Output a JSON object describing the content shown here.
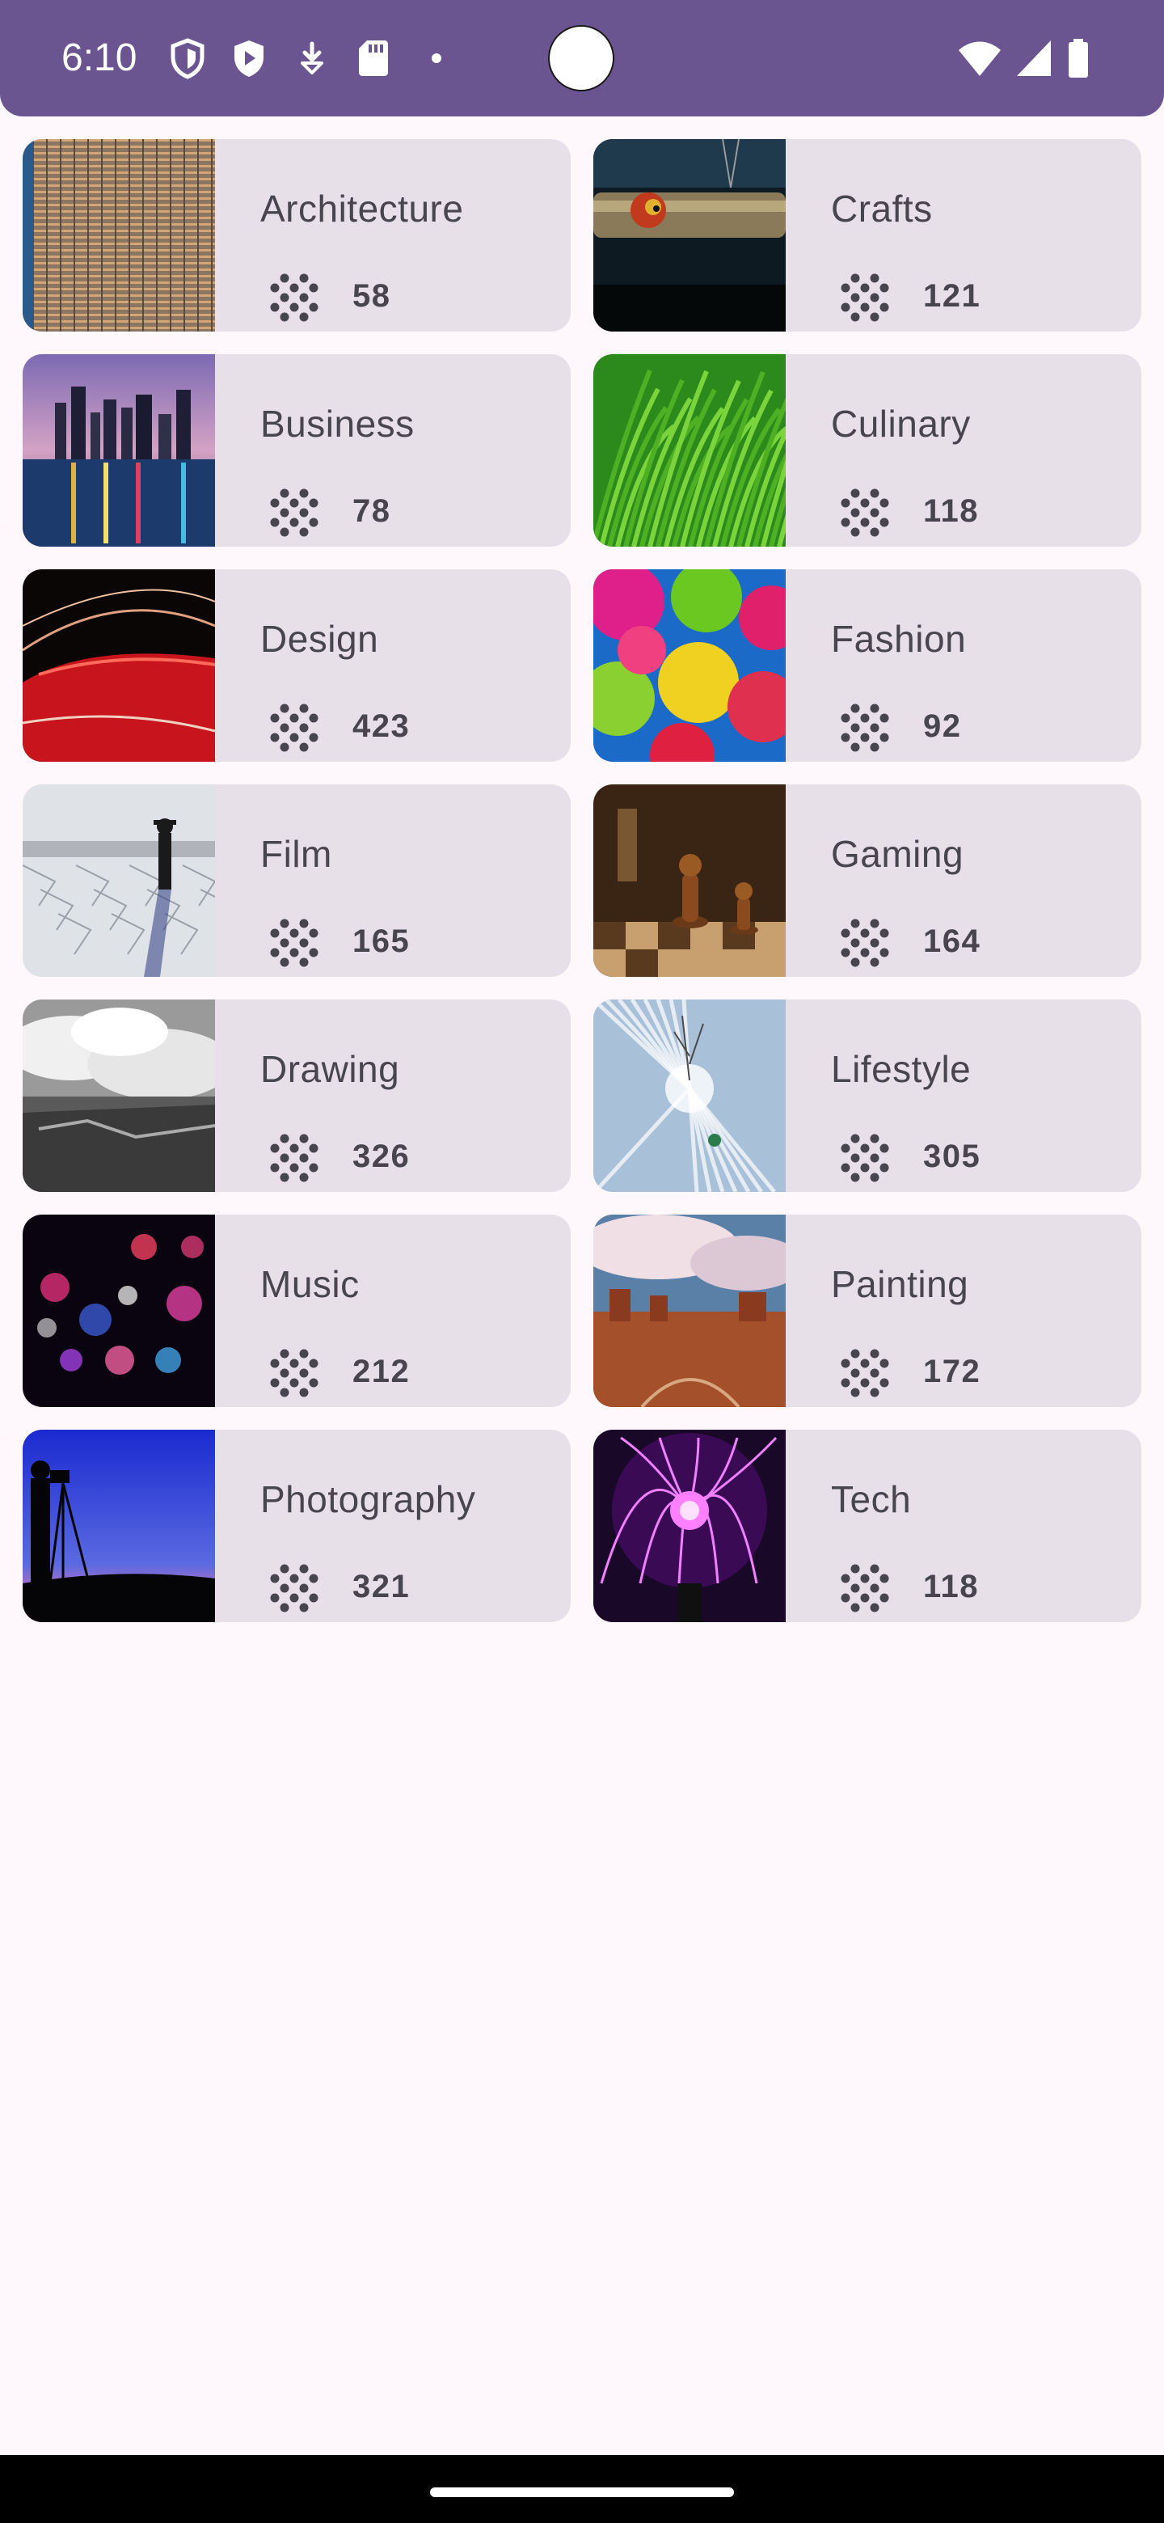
{
  "status_bar": {
    "time": "6:10",
    "icons": [
      "shield-icon",
      "play-protect-icon",
      "download-icon",
      "sd-card-icon",
      "dot-icon",
      "wifi-icon",
      "signal-icon",
      "battery-icon"
    ],
    "background": "#6a5591"
  },
  "categories": [
    {
      "title": "Architecture",
      "count": "58",
      "image": "building-facade-photo"
    },
    {
      "title": "Crafts",
      "count": "121",
      "image": "pipe-bird-photo"
    },
    {
      "title": "Business",
      "count": "78",
      "image": "city-skyline-night-photo"
    },
    {
      "title": "Culinary",
      "count": "118",
      "image": "green-grass-photo"
    },
    {
      "title": "Design",
      "count": "423",
      "image": "red-car-lights-photo"
    },
    {
      "title": "Fashion",
      "count": "92",
      "image": "colorful-umbrellas-photo"
    },
    {
      "title": "Film",
      "count": "165",
      "image": "person-on-salt-flat-photo"
    },
    {
      "title": "Gaming",
      "count": "164",
      "image": "chess-pieces-photo"
    },
    {
      "title": "Drawing",
      "count": "326",
      "image": "clouds-canyon-bw-photo"
    },
    {
      "title": "Lifestyle",
      "count": "305",
      "image": "snowy-skier-photo"
    },
    {
      "title": "Music",
      "count": "212",
      "image": "bokeh-lights-photo"
    },
    {
      "title": "Painting",
      "count": "172",
      "image": "desert-monuments-photo"
    },
    {
      "title": "Photography",
      "count": "321",
      "image": "photographer-silhouette-photo"
    },
    {
      "title": "Tech",
      "count": "118",
      "image": "plasma-ball-photo"
    }
  ],
  "colors": {
    "card_background": "#e7e0e9",
    "text": "#49454f",
    "page_background": "#fef7fc"
  }
}
